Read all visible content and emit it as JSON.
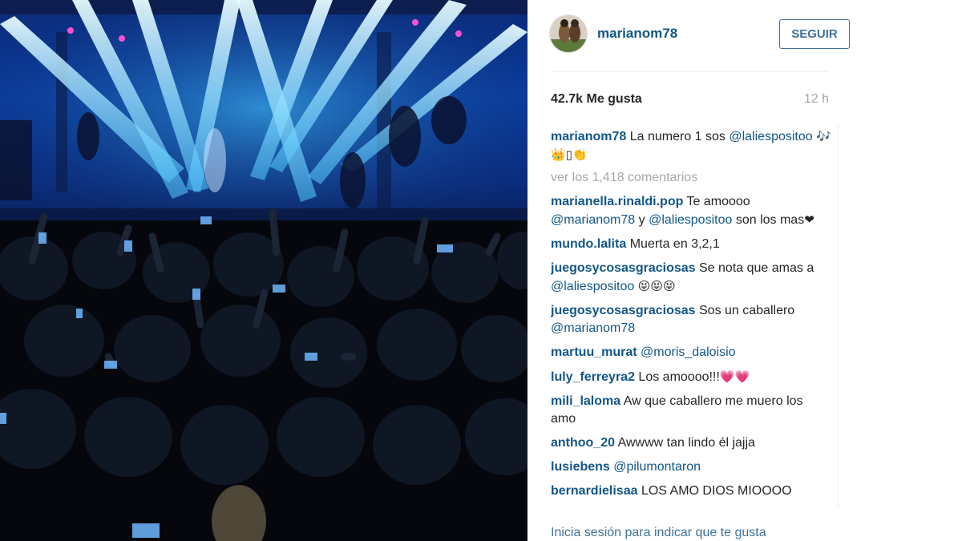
{
  "post": {
    "username": "marianom78",
    "follow_label": "SEGUIR",
    "likes": "42.7k Me gusta",
    "time": "12 h",
    "caption": {
      "user": "marianom78",
      "text": "La numero 1 sos",
      "mention": "@laliespositoo",
      "emoji": "🎶👑▯👏"
    },
    "view_comments": "ver los 1,418 comentarios",
    "login_prompt": "Inicia sesión para indicar que te gusta"
  },
  "comments": [
    {
      "user": "marianella.rinaldi.pop",
      "pre": "Te amoooo",
      "m1": "@marianom78",
      "mid": "y",
      "m2": "@laliespositoo",
      "post": "son los mas",
      "emoji": "❤"
    },
    {
      "user": "mundo.lalita",
      "text": "Muerta en 3,2,1"
    },
    {
      "user": "juegosycosasgraciosas",
      "pre": "Se nota que amas a",
      "m1": "@laliespositoo",
      "emoji": "😝😝😝"
    },
    {
      "user": "juegosycosasgraciosas",
      "pre": "Sos un caballero",
      "m1": "@marianom78"
    },
    {
      "user": "martuu_murat",
      "m1": "@moris_daloisio"
    },
    {
      "user": "luly_ferreyra2",
      "text": "Los amoooo!!!",
      "emoji": "💗💗"
    },
    {
      "user": "mili_laloma",
      "text": "Aw que caballero me muero los amo"
    },
    {
      "user": "anthoo_20",
      "text": "Awwww tan lindo él jajja"
    },
    {
      "user": "lusiebens",
      "m1": "@pilumontaron"
    },
    {
      "user": "bernardielisaa",
      "text": "LOS AMO DIOS MIOOOO"
    }
  ],
  "colors": {
    "link": "#125688",
    "button": "#3f729b",
    "muted": "#a5a7aa",
    "stage_light": "#5fd3ff"
  },
  "icons": {
    "avatar": "profile-photo",
    "photo": "concert-photo"
  }
}
